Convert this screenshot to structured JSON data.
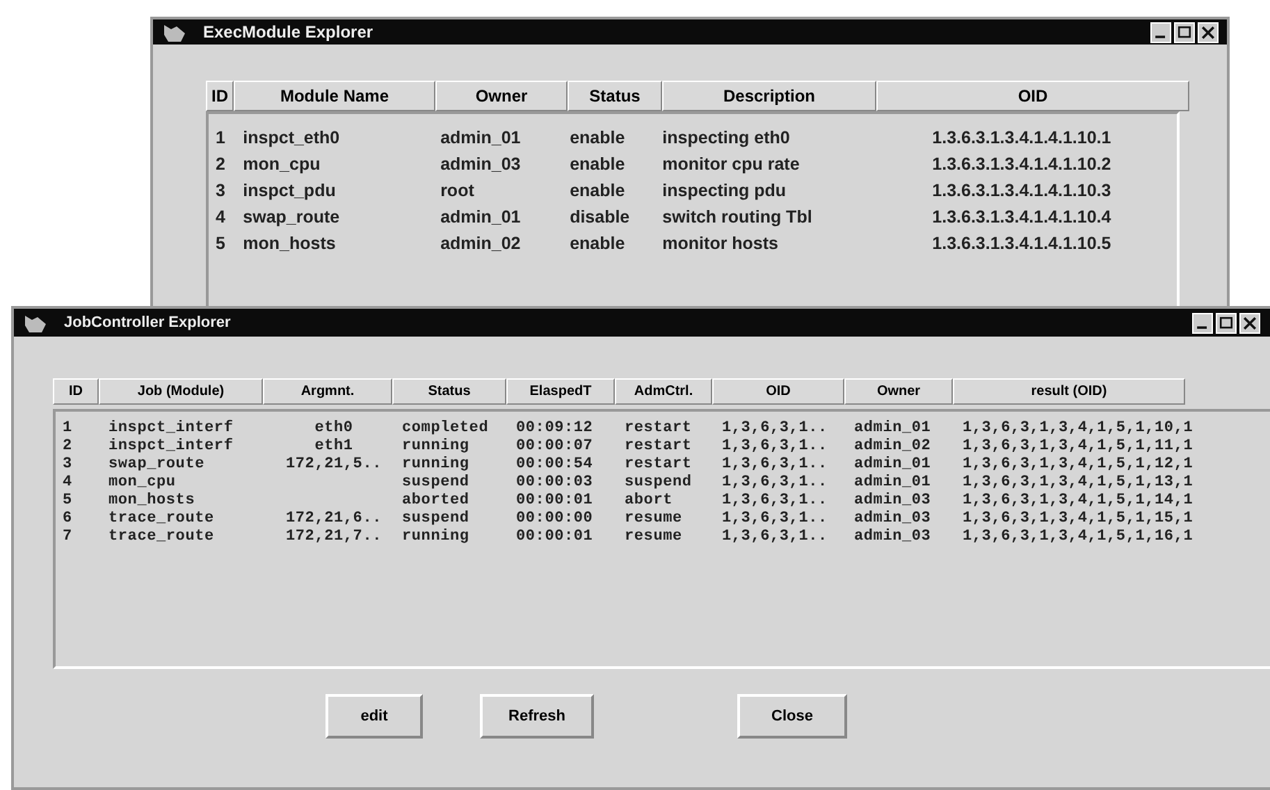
{
  "windows": [
    {
      "title": "ExecModule Explorer",
      "columns": [
        "ID",
        "Module Name",
        "Owner",
        "Status",
        "Description",
        "OID"
      ],
      "rows": [
        [
          "1",
          "inspct_eth0",
          "admin_01",
          "enable",
          "inspecting eth0",
          "1.3.6.3.1.3.4.1.4.1.10.1"
        ],
        [
          "2",
          "mon_cpu",
          "admin_03",
          "enable",
          "monitor cpu rate",
          "1.3.6.3.1.3.4.1.4.1.10.2"
        ],
        [
          "3",
          "inspct_pdu",
          "root",
          "enable",
          "inspecting pdu",
          "1.3.6.3.1.3.4.1.4.1.10.3"
        ],
        [
          "4",
          "swap_route",
          "admin_01",
          "disable",
          "switch routing Tbl",
          "1.3.6.3.1.3.4.1.4.1.10.4"
        ],
        [
          "5",
          "mon_hosts",
          "admin_02",
          "enable",
          "monitor hosts",
          "1.3.6.3.1.3.4.1.4.1.10.5"
        ]
      ]
    },
    {
      "title": "JobController Explorer",
      "columns": [
        "ID",
        "Job (Module)",
        "Argmnt.",
        "Status",
        "ElaspedT",
        "AdmCtrl.",
        "OID",
        "Owner",
        "result (OID)"
      ],
      "rows": [
        [
          "1",
          "inspct_interf",
          "eth0",
          "completed",
          "00:09:12",
          "restart",
          "1,3,6,3,1..",
          "admin_01",
          "1,3,6,3,1,3,4,1,5,1,10,1"
        ],
        [
          "2",
          "inspct_interf",
          "eth1",
          "running",
          "00:00:07",
          "restart",
          "1,3,6,3,1..",
          "admin_02",
          "1,3,6,3,1,3,4,1,5,1,11,1"
        ],
        [
          "3",
          "swap_route",
          "172,21,5..",
          "running",
          "00:00:54",
          "restart",
          "1,3,6,3,1..",
          "admin_01",
          "1,3,6,3,1,3,4,1,5,1,12,1"
        ],
        [
          "4",
          "mon_cpu",
          "",
          "suspend",
          "00:00:03",
          "suspend",
          "1,3,6,3,1..",
          "admin_01",
          "1,3,6,3,1,3,4,1,5,1,13,1"
        ],
        [
          "5",
          "mon_hosts",
          "",
          "aborted",
          "00:00:01",
          "abort",
          "1,3,6,3,1..",
          "admin_03",
          "1,3,6,3,1,3,4,1,5,1,14,1"
        ],
        [
          "6",
          "trace_route",
          "172,21,6..",
          "suspend",
          "00:00:00",
          "resume",
          "1,3,6,3,1..",
          "admin_03",
          "1,3,6,3,1,3,4,1,5,1,15,1"
        ],
        [
          "7",
          "trace_route",
          "172,21,7..",
          "running",
          "00:00:01",
          "resume",
          "1,3,6,3,1..",
          "admin_03",
          "1,3,6,3,1,3,4,1,5,1,16,1"
        ]
      ],
      "buttons": [
        "edit",
        "Refresh",
        "Close"
      ]
    }
  ]
}
